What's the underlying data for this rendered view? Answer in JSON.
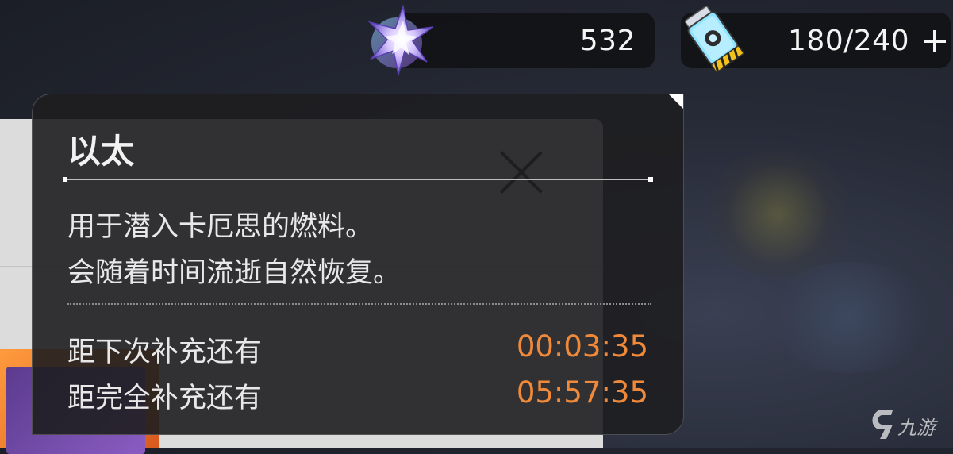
{
  "resources": {
    "crystal": {
      "icon": "star-crystal-icon",
      "value": "532"
    },
    "fuel": {
      "icon": "ether-canister-icon",
      "value": "180/240",
      "add_icon": "plus-icon"
    }
  },
  "tooltip": {
    "title": "以太",
    "description": [
      "用于潜入卡厄思的燃料。",
      "会随着时间流逝自然恢复。"
    ],
    "timers": [
      {
        "label": "距下次补充还有",
        "value": "00:03:35"
      },
      {
        "label": "距完全补充还有",
        "value": "05:57:35"
      }
    ]
  },
  "background": {
    "close_icon": "close-icon"
  },
  "watermark": {
    "logo": "jiuyou-logo",
    "text": "九游"
  },
  "colors": {
    "timer_accent": "#f08a3a",
    "tooltip_bg": "#1e1e20"
  }
}
